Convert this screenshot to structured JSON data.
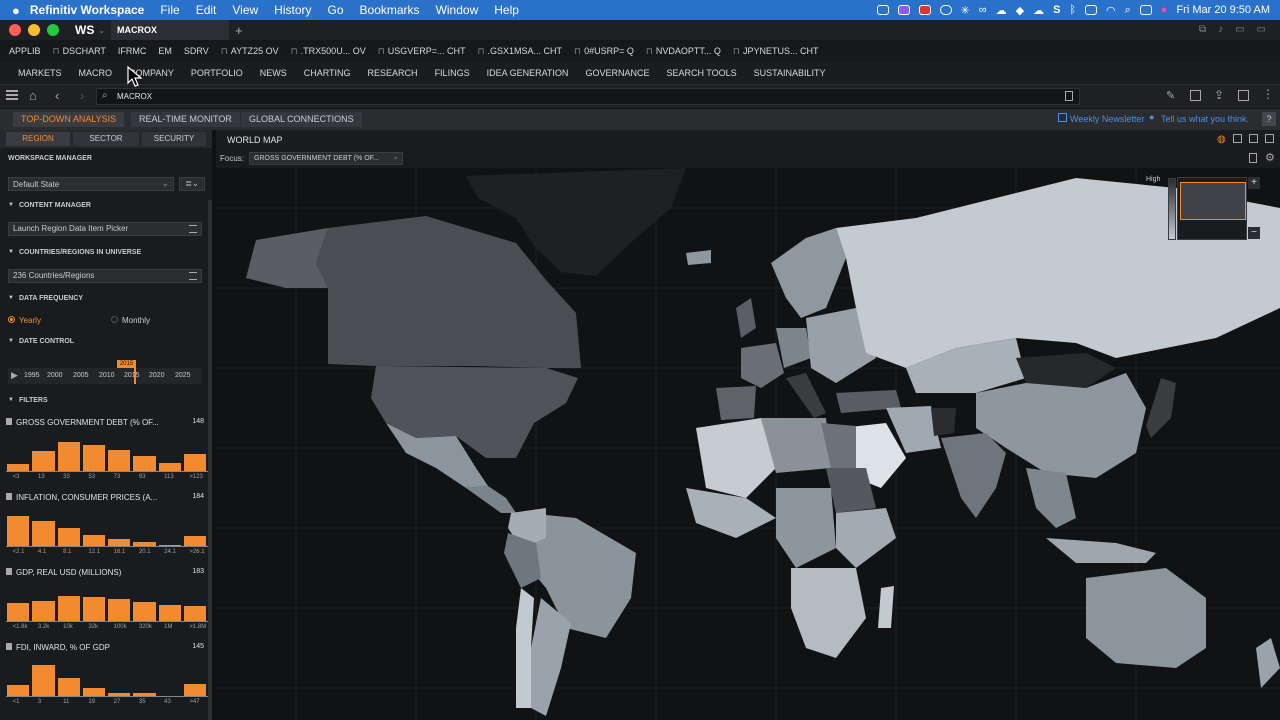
{
  "menubar": {
    "app_name": "Refinitiv Workspace",
    "items": [
      "File",
      "Edit",
      "View",
      "History",
      "Go",
      "Bookmarks",
      "Window",
      "Help"
    ],
    "clock": "Fri Mar 20  9:50 AM"
  },
  "window": {
    "logo": "WS",
    "tab_title": "MACROX",
    "new_tab": "+"
  },
  "quicklinks": [
    "APPLIB",
    "DSCHART",
    "IFRMC",
    "EM",
    "SDRV",
    "AYTZ25 OV",
    ".TRX500U... OV",
    "USGVERP=... CHT",
    ".GSX1MSA... CHT",
    "0#USRP= Q",
    "NVDAOPTT... Q",
    "JPYNETUS... CHT"
  ],
  "nav": [
    "MARKETS",
    "MACRO",
    "COMPANY",
    "PORTFOLIO",
    "NEWS",
    "CHARTING",
    "RESEARCH",
    "FILINGS",
    "IDEA GENERATION",
    "GOVERNANCE",
    "SEARCH TOOLS",
    "SUSTAINABILITY"
  ],
  "search": {
    "value": "MACROX"
  },
  "subtabs": {
    "top_down": "TOP-DOWN ANALYSIS",
    "realtime": "REAL-TIME MONITOR",
    "global": "GLOBAL CONNECTIONS",
    "newsletter": "Weekly Newsletter",
    "feedback": "Tell us what you think.",
    "help": "?"
  },
  "left": {
    "tabs": [
      "REGION",
      "SECTOR",
      "SECURITY"
    ],
    "workspace_manager": "WORKSPACE MANAGER",
    "state": "Default State",
    "content_manager": "CONTENT MANAGER",
    "picker": "Launch Region Data Item Picker",
    "countries_header": "COUNTRIES/REGIONS IN UNIVERSE",
    "countries_count": "236",
    "countries_label": "Countries/Regions",
    "freq_header": "DATA FREQUENCY",
    "freq_yearly": "Yearly",
    "freq_monthly": "Monthly",
    "date_header": "DATE CONTROL",
    "date_selected": "2015",
    "date_ticks": [
      "1995",
      "2000",
      "2005",
      "2010",
      "2015",
      "2020",
      "2025"
    ],
    "filters_header": "FILTERS"
  },
  "histograms": [
    {
      "title": "GROSS GOVERNMENT DEBT (% OF...",
      "count": "148",
      "ticks": [
        "<3",
        "13",
        "33",
        "53",
        "73",
        "93",
        "113",
        ">123"
      ],
      "levels": [
        0.18,
        0.5,
        0.72,
        0.66,
        0.52,
        0.38,
        0.2,
        0.42
      ]
    },
    {
      "title": "INFLATION, CONSUMER PRICES (A...",
      "count": "184",
      "ticks": [
        "<2.1",
        "4.1",
        "8.1",
        "12.1",
        "16.1",
        "20.1",
        "24.1",
        ">26.1"
      ],
      "levels": [
        0.75,
        0.62,
        0.46,
        0.28,
        0.18,
        0.1,
        0.02,
        0.26
      ]
    },
    {
      "title": "GDP, REAL USD (MILLIONS)",
      "count": "183",
      "ticks": [
        "<1.8k",
        "3.2k",
        "10k",
        "32k",
        "100k",
        "320k",
        "1M",
        ">1.8M"
      ],
      "levels": [
        0.46,
        0.5,
        0.62,
        0.6,
        0.56,
        0.48,
        0.4,
        0.38
      ]
    },
    {
      "title": "FDI, INWARD, % OF GDP",
      "count": "145",
      "ticks": [
        "<1",
        "3",
        "11",
        "19",
        "27",
        "35",
        "43",
        ">47"
      ],
      "levels": [
        0.28,
        0.78,
        0.46,
        0.2,
        0.08,
        0.08,
        0.0,
        0.3
      ]
    }
  ],
  "map": {
    "title": "WORLD MAP",
    "focus_label": "Focus:",
    "focus_value": "GROSS GOVERNMENT DEBT (% OF...",
    "legend_label": "High",
    "zoom_in": "+",
    "zoom_out": "−"
  }
}
